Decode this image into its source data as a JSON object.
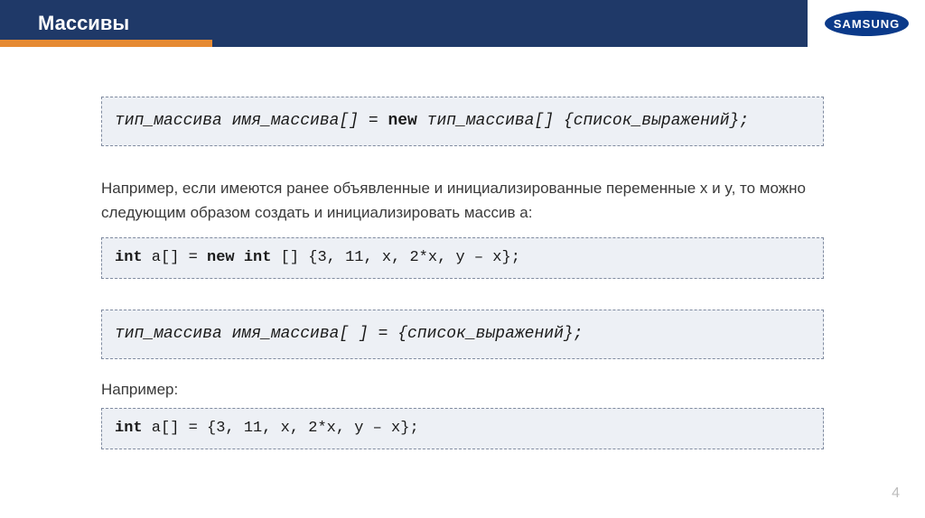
{
  "header": {
    "title": "Массивы",
    "logo_text": "SAMSUNG"
  },
  "code1": {
    "prefix": "тип_массива имя_массива[] = ",
    "kw": "new",
    "suffix": " тип_массива[] {список_выражений};"
  },
  "para1": "Например, если имеются ранее объявленные и инициализированные переменные x и y, то можно следующим образом создать и инициализировать массив a:",
  "code2": {
    "p1": "int",
    "p2": " a[] = ",
    "p3": "new int",
    "p4": " [] {3, 11, x, 2*x, y – x};"
  },
  "code3": "тип_массива имя_массива[ ] = {список_выражений};",
  "para2": "Например:",
  "code4": {
    "p1": "int",
    "p2": " a[] = {3, 11, x, 2*x, y – x};"
  },
  "page_number": "4"
}
